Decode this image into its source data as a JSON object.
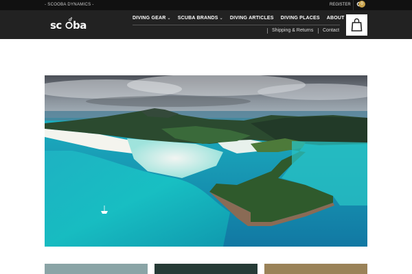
{
  "topbar": {
    "tagline": "- SCOOBA DYNAMICS -",
    "register": "REGISTER",
    "search_icon": "search-icon"
  },
  "header": {
    "logo": "scuba",
    "nav": [
      {
        "label": "DIVING GEAR",
        "dropdown": true
      },
      {
        "label": "SCUBA BRANDS",
        "dropdown": true
      },
      {
        "label": "DIVING ARTICLES",
        "dropdown": false
      },
      {
        "label": "DIVING PLACES",
        "dropdown": false
      },
      {
        "label": "ABOUT",
        "dropdown": true
      }
    ],
    "subnav": [
      "Shipping & Returns",
      "Contact"
    ],
    "cart_count": "0",
    "cart_icon": "shopping-bag-icon"
  },
  "colors": {
    "topbar_bg": "#111111",
    "header_bg": "#222222",
    "badge": "#c8a24a",
    "sea_turquoise": "#1ec8c8"
  }
}
